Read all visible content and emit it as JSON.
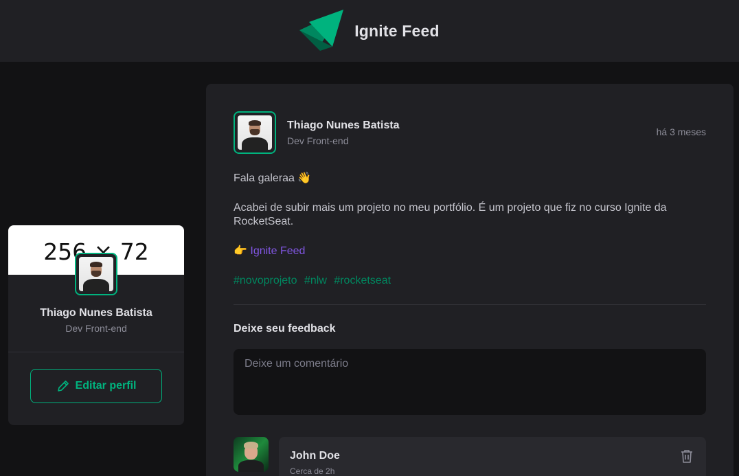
{
  "header": {
    "title": "Ignite Feed",
    "logo_icon": "ignite-logo-icon",
    "accent": "#00b37e"
  },
  "sidebar": {
    "cover_text": "256 × 72",
    "name": "Thiago Nunes Batista",
    "role": "Dev Front-end",
    "edit_button": "Editar perfil",
    "edit_icon": "pencil-icon"
  },
  "post": {
    "author": {
      "name": "Thiago Nunes Batista",
      "role": "Dev Front-end"
    },
    "time": "há 3 meses",
    "greeting": "Fala galeraa 👋",
    "paragraph": "Acabei de subir mais um projeto no meu portfólio. É um projeto que fiz no curso Ignite da RocketSeat.",
    "link_prefix": "👉 ",
    "link_text": "Ignite Feed",
    "hashtags": [
      "#novoprojeto",
      "#nlw",
      "#rocketseat"
    ],
    "feedback_title": "Deixe seu feedback",
    "comment_placeholder": "Deixe um comentário"
  },
  "comments": [
    {
      "author": "John Doe",
      "time": "Cerca de 2h",
      "delete_icon": "trash-icon"
    }
  ],
  "colors": {
    "background": "#121214",
    "card": "#202024",
    "green": "#00b37e",
    "link": "#8257e5"
  }
}
